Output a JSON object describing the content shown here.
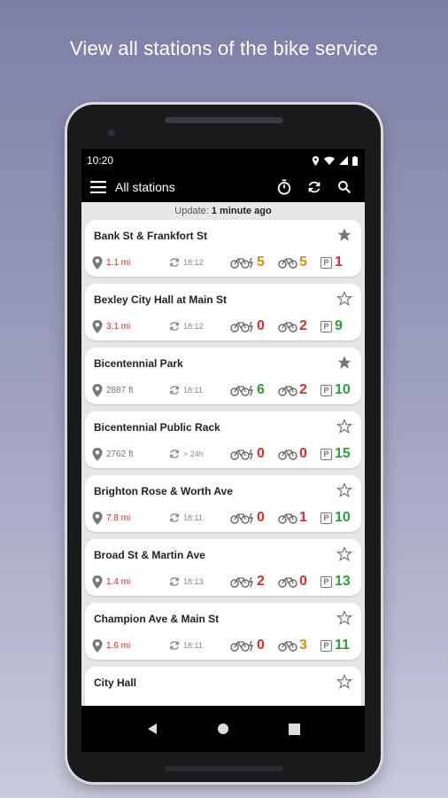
{
  "caption": "View all stations of the bike service",
  "status": {
    "time": "10:20"
  },
  "toolbar": {
    "title": "All stations"
  },
  "update": {
    "label": "Update:",
    "value": "1 minute ago"
  },
  "colors": {
    "red": "#d32f2f",
    "green": "#2e9e3a",
    "orange": "#d98c14",
    "gray": "#777777"
  },
  "stations": [
    {
      "name": "Bank St & Frankfort St",
      "favorite": true,
      "distance": "1.1 mi",
      "distance_color": "#d32f2f",
      "time": "18:12",
      "ebikes": "5",
      "ebikes_color": "#d98c14",
      "bikes": "5",
      "bikes_color": "#d98c14",
      "parking": "1",
      "parking_color": "#d32f2f"
    },
    {
      "name": "Bexley City Hall at Main St",
      "favorite": false,
      "distance": "3.1 mi",
      "distance_color": "#d32f2f",
      "time": "18:12",
      "ebikes": "0",
      "ebikes_color": "#d32f2f",
      "bikes": "2",
      "bikes_color": "#d32f2f",
      "parking": "9",
      "parking_color": "#2e9e3a"
    },
    {
      "name": "Bicentennial Park",
      "favorite": true,
      "distance": "2887 ft",
      "distance_color": "#777777",
      "time": "18:11",
      "ebikes": "6",
      "ebikes_color": "#2e9e3a",
      "bikes": "2",
      "bikes_color": "#d32f2f",
      "parking": "10",
      "parking_color": "#2e9e3a"
    },
    {
      "name": "Bicentennial Public Rack",
      "favorite": false,
      "distance": "2762 ft",
      "distance_color": "#777777",
      "time": "> 24h",
      "ebikes": "0",
      "ebikes_color": "#d32f2f",
      "bikes": "0",
      "bikes_color": "#d32f2f",
      "parking": "15",
      "parking_color": "#2e9e3a"
    },
    {
      "name": "Brighton Rose & Worth Ave",
      "favorite": false,
      "distance": "7.8 mi",
      "distance_color": "#d32f2f",
      "time": "18:11",
      "ebikes": "0",
      "ebikes_color": "#d32f2f",
      "bikes": "1",
      "bikes_color": "#d32f2f",
      "parking": "10",
      "parking_color": "#2e9e3a"
    },
    {
      "name": "Broad St & Martin Ave",
      "favorite": false,
      "distance": "1.4 mi",
      "distance_color": "#d32f2f",
      "time": "18:13",
      "ebikes": "2",
      "ebikes_color": "#d32f2f",
      "bikes": "0",
      "bikes_color": "#d32f2f",
      "parking": "13",
      "parking_color": "#2e9e3a"
    },
    {
      "name": "Champion Ave & Main St",
      "favorite": false,
      "distance": "1.6 mi",
      "distance_color": "#d32f2f",
      "time": "18:11",
      "ebikes": "0",
      "ebikes_color": "#d32f2f",
      "bikes": "3",
      "bikes_color": "#d98c14",
      "parking": "11",
      "parking_color": "#2e9e3a"
    },
    {
      "name": "City Hall",
      "favorite": false,
      "distance": "",
      "distance_color": "#777777",
      "time": "",
      "ebikes": "",
      "ebikes_color": "#d32f2f",
      "bikes": "",
      "bikes_color": "#d32f2f",
      "parking": "",
      "parking_color": "#2e9e3a"
    }
  ]
}
